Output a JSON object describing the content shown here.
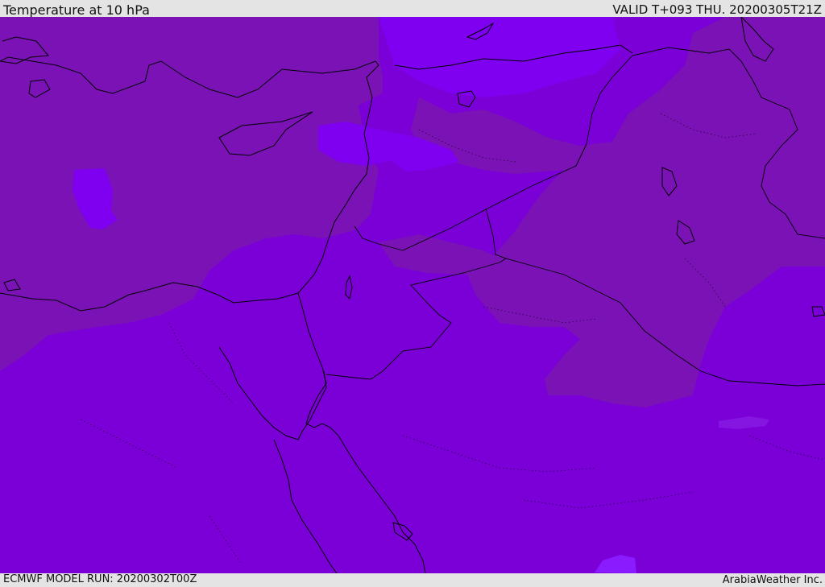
{
  "header": {
    "title": "Temperature at 10 hPa",
    "valid_time": "VALID T+093 THU. 20200305T21Z"
  },
  "footer": {
    "model_run": "ECMWF MODEL RUN: 20200302T00Z",
    "credit": "ArabiaWeather Inc."
  },
  "map": {
    "colors": {
      "background": "#7b00d8",
      "cold_band": "#7a12b6",
      "lighter_patch": "#7f00f0",
      "accent_spot": "#8a1bff",
      "coast": "#000000",
      "chrome": "#e4e4e4"
    }
  }
}
